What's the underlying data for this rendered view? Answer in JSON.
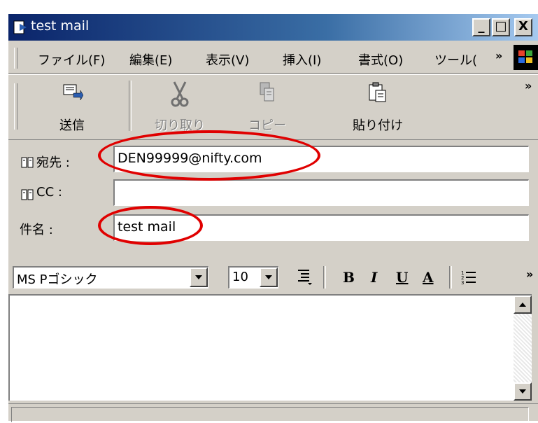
{
  "window": {
    "title": "test mail",
    "controls": [
      "_",
      "□",
      "X"
    ]
  },
  "menu": [
    "ファイル(F)",
    "編集(E)",
    "表示(V)",
    "挿入(I)",
    "書式(O)",
    "ツール(",
    "»"
  ],
  "toolbar": {
    "send_label": "送信",
    "cut_label": "切り取り",
    "copy_label": "コピー",
    "paste_label": "貼り付け",
    "more": "»"
  },
  "fields": {
    "to_label": "宛先 :",
    "to_value": "DEN99999@nifty.com",
    "cc_label": "CC :",
    "cc_value": "",
    "subject_label": "件名 :",
    "subject_value": "test mail"
  },
  "format": {
    "font_name": "MS Pゴシック",
    "font_size": "10",
    "bold": "B",
    "italic": "I",
    "underline": "U",
    "color": "A",
    "more": "»"
  },
  "icons": [
    "document-icon",
    "winlogo-icon",
    "send-icon",
    "cut-icon",
    "copy-icon",
    "paste-icon",
    "address-book-icon",
    "align-icon",
    "list-icon"
  ],
  "colors": {
    "title_start": "#0a246a",
    "title_end": "#a6caf0",
    "annotation": "#e00000"
  }
}
